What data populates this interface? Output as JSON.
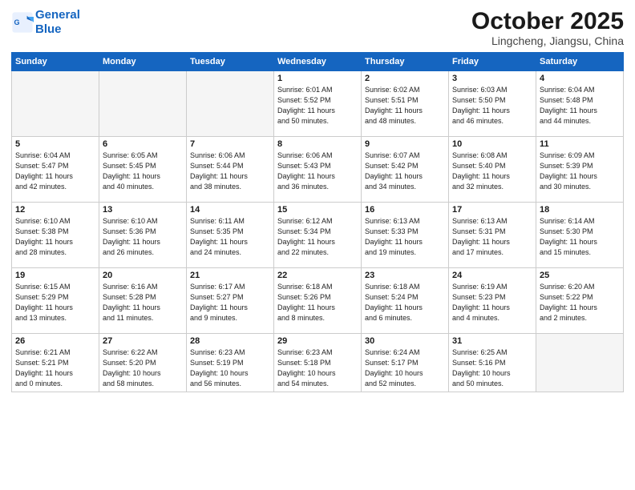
{
  "header": {
    "logo_line1": "General",
    "logo_line2": "Blue",
    "title": "October 2025",
    "subtitle": "Lingcheng, Jiangsu, China"
  },
  "days_of_week": [
    "Sunday",
    "Monday",
    "Tuesday",
    "Wednesday",
    "Thursday",
    "Friday",
    "Saturday"
  ],
  "weeks": [
    [
      {
        "num": "",
        "info": ""
      },
      {
        "num": "",
        "info": ""
      },
      {
        "num": "",
        "info": ""
      },
      {
        "num": "1",
        "info": "Sunrise: 6:01 AM\nSunset: 5:52 PM\nDaylight: 11 hours\nand 50 minutes."
      },
      {
        "num": "2",
        "info": "Sunrise: 6:02 AM\nSunset: 5:51 PM\nDaylight: 11 hours\nand 48 minutes."
      },
      {
        "num": "3",
        "info": "Sunrise: 6:03 AM\nSunset: 5:50 PM\nDaylight: 11 hours\nand 46 minutes."
      },
      {
        "num": "4",
        "info": "Sunrise: 6:04 AM\nSunset: 5:48 PM\nDaylight: 11 hours\nand 44 minutes."
      }
    ],
    [
      {
        "num": "5",
        "info": "Sunrise: 6:04 AM\nSunset: 5:47 PM\nDaylight: 11 hours\nand 42 minutes."
      },
      {
        "num": "6",
        "info": "Sunrise: 6:05 AM\nSunset: 5:45 PM\nDaylight: 11 hours\nand 40 minutes."
      },
      {
        "num": "7",
        "info": "Sunrise: 6:06 AM\nSunset: 5:44 PM\nDaylight: 11 hours\nand 38 minutes."
      },
      {
        "num": "8",
        "info": "Sunrise: 6:06 AM\nSunset: 5:43 PM\nDaylight: 11 hours\nand 36 minutes."
      },
      {
        "num": "9",
        "info": "Sunrise: 6:07 AM\nSunset: 5:42 PM\nDaylight: 11 hours\nand 34 minutes."
      },
      {
        "num": "10",
        "info": "Sunrise: 6:08 AM\nSunset: 5:40 PM\nDaylight: 11 hours\nand 32 minutes."
      },
      {
        "num": "11",
        "info": "Sunrise: 6:09 AM\nSunset: 5:39 PM\nDaylight: 11 hours\nand 30 minutes."
      }
    ],
    [
      {
        "num": "12",
        "info": "Sunrise: 6:10 AM\nSunset: 5:38 PM\nDaylight: 11 hours\nand 28 minutes."
      },
      {
        "num": "13",
        "info": "Sunrise: 6:10 AM\nSunset: 5:36 PM\nDaylight: 11 hours\nand 26 minutes."
      },
      {
        "num": "14",
        "info": "Sunrise: 6:11 AM\nSunset: 5:35 PM\nDaylight: 11 hours\nand 24 minutes."
      },
      {
        "num": "15",
        "info": "Sunrise: 6:12 AM\nSunset: 5:34 PM\nDaylight: 11 hours\nand 22 minutes."
      },
      {
        "num": "16",
        "info": "Sunrise: 6:13 AM\nSunset: 5:33 PM\nDaylight: 11 hours\nand 19 minutes."
      },
      {
        "num": "17",
        "info": "Sunrise: 6:13 AM\nSunset: 5:31 PM\nDaylight: 11 hours\nand 17 minutes."
      },
      {
        "num": "18",
        "info": "Sunrise: 6:14 AM\nSunset: 5:30 PM\nDaylight: 11 hours\nand 15 minutes."
      }
    ],
    [
      {
        "num": "19",
        "info": "Sunrise: 6:15 AM\nSunset: 5:29 PM\nDaylight: 11 hours\nand 13 minutes."
      },
      {
        "num": "20",
        "info": "Sunrise: 6:16 AM\nSunset: 5:28 PM\nDaylight: 11 hours\nand 11 minutes."
      },
      {
        "num": "21",
        "info": "Sunrise: 6:17 AM\nSunset: 5:27 PM\nDaylight: 11 hours\nand 9 minutes."
      },
      {
        "num": "22",
        "info": "Sunrise: 6:18 AM\nSunset: 5:26 PM\nDaylight: 11 hours\nand 8 minutes."
      },
      {
        "num": "23",
        "info": "Sunrise: 6:18 AM\nSunset: 5:24 PM\nDaylight: 11 hours\nand 6 minutes."
      },
      {
        "num": "24",
        "info": "Sunrise: 6:19 AM\nSunset: 5:23 PM\nDaylight: 11 hours\nand 4 minutes."
      },
      {
        "num": "25",
        "info": "Sunrise: 6:20 AM\nSunset: 5:22 PM\nDaylight: 11 hours\nand 2 minutes."
      }
    ],
    [
      {
        "num": "26",
        "info": "Sunrise: 6:21 AM\nSunset: 5:21 PM\nDaylight: 11 hours\nand 0 minutes."
      },
      {
        "num": "27",
        "info": "Sunrise: 6:22 AM\nSunset: 5:20 PM\nDaylight: 10 hours\nand 58 minutes."
      },
      {
        "num": "28",
        "info": "Sunrise: 6:23 AM\nSunset: 5:19 PM\nDaylight: 10 hours\nand 56 minutes."
      },
      {
        "num": "29",
        "info": "Sunrise: 6:23 AM\nSunset: 5:18 PM\nDaylight: 10 hours\nand 54 minutes."
      },
      {
        "num": "30",
        "info": "Sunrise: 6:24 AM\nSunset: 5:17 PM\nDaylight: 10 hours\nand 52 minutes."
      },
      {
        "num": "31",
        "info": "Sunrise: 6:25 AM\nSunset: 5:16 PM\nDaylight: 10 hours\nand 50 minutes."
      },
      {
        "num": "",
        "info": ""
      }
    ]
  ]
}
